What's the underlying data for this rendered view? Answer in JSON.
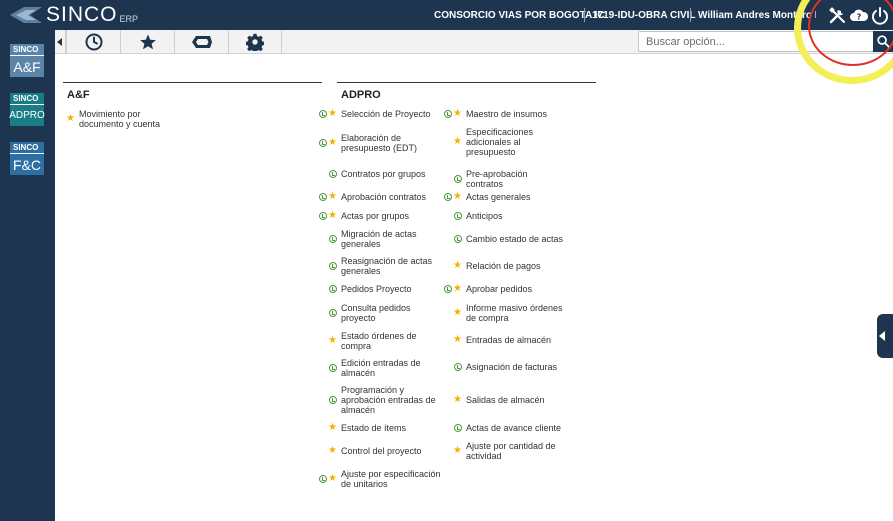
{
  "header": {
    "logo_text": "SINCO",
    "logo_sub": "ERP",
    "company": "CONSORCIO VIAS POR BOGOTA IC",
    "project": "1719-IDU-OBRA CIVIL",
    "user": "William Andres Montero Ruiz"
  },
  "sidebar": {
    "apps": [
      {
        "brand": "SINCO",
        "code": "A&F"
      },
      {
        "brand": "SINCO",
        "code": "ADPRO"
      },
      {
        "brand": "SINCO",
        "code": "F&C"
      }
    ]
  },
  "toolbar": {
    "search_placeholder": "Buscar opción..."
  },
  "sections": {
    "af": {
      "title": "A&F",
      "items": [
        {
          "label": "Movimiento por documento y cuenta",
          "fav": true,
          "history": false
        }
      ]
    },
    "adpro": {
      "title": "ADPRO",
      "col1": [
        {
          "label": "Selección de Proyecto",
          "fav": true,
          "history": true
        },
        {
          "label": "Elaboración de presupuesto (EDT)",
          "fav": true,
          "history": true
        },
        {
          "label": "Contratos por grupos",
          "fav": false,
          "history": true
        },
        {
          "label": "Aprobación contratos",
          "fav": true,
          "history": true
        },
        {
          "label": "Actas por grupos",
          "fav": true,
          "history": true
        },
        {
          "label": "Migración de actas generales",
          "fav": false,
          "history": true
        },
        {
          "label": "Reasignación de actas generales",
          "fav": false,
          "history": true
        },
        {
          "label": "Pedidos Proyecto",
          "fav": false,
          "history": true
        },
        {
          "label": "Consulta pedidos proyecto",
          "fav": false,
          "history": true
        },
        {
          "label": "Estado órdenes de compra",
          "fav": true,
          "history": false
        },
        {
          "label": "Edición entradas de almacén",
          "fav": false,
          "history": true
        },
        {
          "label": "Programación y aprobación entradas de almacén",
          "fav": false,
          "history": true
        },
        {
          "label": "Estado de ítems",
          "fav": true,
          "history": false
        },
        {
          "label": "Control del proyecto",
          "fav": true,
          "history": false
        },
        {
          "label": "Ajuste por especificación de unitarios",
          "fav": true,
          "history": true
        }
      ],
      "col2": [
        {
          "label": "Maestro de insumos",
          "fav": true,
          "history": true
        },
        {
          "label": "Especificaciones adicionales al presupuesto",
          "fav": true,
          "history": false
        },
        {
          "label": "Pre-aprobación contratos",
          "fav": false,
          "history": true
        },
        {
          "label": "Actas generales",
          "fav": true,
          "history": true
        },
        {
          "label": "Anticipos",
          "fav": false,
          "history": true
        },
        {
          "label": "Cambio estado de actas",
          "fav": false,
          "history": true
        },
        {
          "label": "Relación de pagos",
          "fav": true,
          "history": false
        },
        {
          "label": "Aprobar pedidos",
          "fav": true,
          "history": true
        },
        {
          "label": "Informe masivo órdenes de compra",
          "fav": true,
          "history": false
        },
        {
          "label": "Entradas de almacén",
          "fav": true,
          "history": false
        },
        {
          "label": "Asignación de facturas",
          "fav": false,
          "history": true
        },
        {
          "label": "Salidas de almacén",
          "fav": true,
          "history": false
        },
        {
          "label": "Actas de avance cliente",
          "fav": false,
          "history": true
        },
        {
          "label": "Ajuste por cantidad de actividad",
          "fav": true,
          "history": false
        }
      ]
    }
  },
  "colors": {
    "navy": "#1e3550",
    "star": "#f2b200",
    "clock": "#4e9a3e",
    "highlight_ring": "#f4ef57",
    "cursor_ring": "#e0302c"
  },
  "icons": [
    "clock-icon",
    "star-icon",
    "tag-icon",
    "gear-icon",
    "tools-icon",
    "help-cloud-icon",
    "power-icon",
    "search-icon"
  ]
}
